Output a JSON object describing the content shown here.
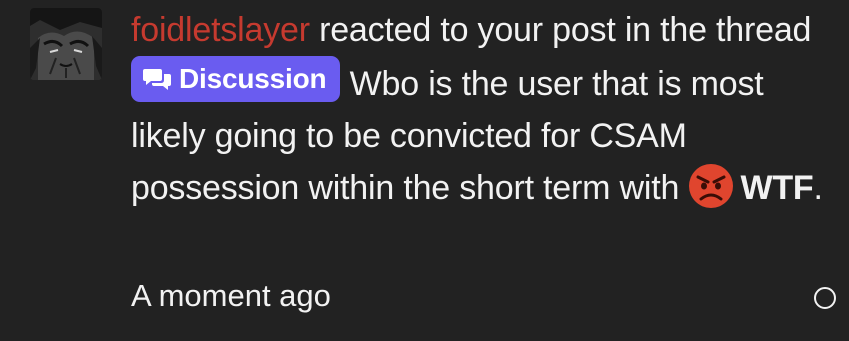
{
  "notification": {
    "avatar_icon": "user-avatar-dark-art",
    "username": "foidletslayer",
    "text_before_thread": "reacted to your post in the thread",
    "thread_prefix": {
      "icon": "chat-bubbles-icon",
      "label": "Discussion"
    },
    "thread_title": "Wbo is the user that is most likely going to be convicted for CSAM possession within the short term",
    "text_after_thread": "with",
    "reaction": {
      "icon": "angry-face-emoji",
      "label": "WTF",
      "suffix": "."
    },
    "timestamp": "A moment ago",
    "read_toggle_icon": "circle-outline-icon"
  },
  "colors": {
    "background": "#222222",
    "text": "#f2f2f2",
    "username": "#c63a2f",
    "prefix_badge": "#6a5cf0",
    "emoji_red": "#e0452e"
  }
}
